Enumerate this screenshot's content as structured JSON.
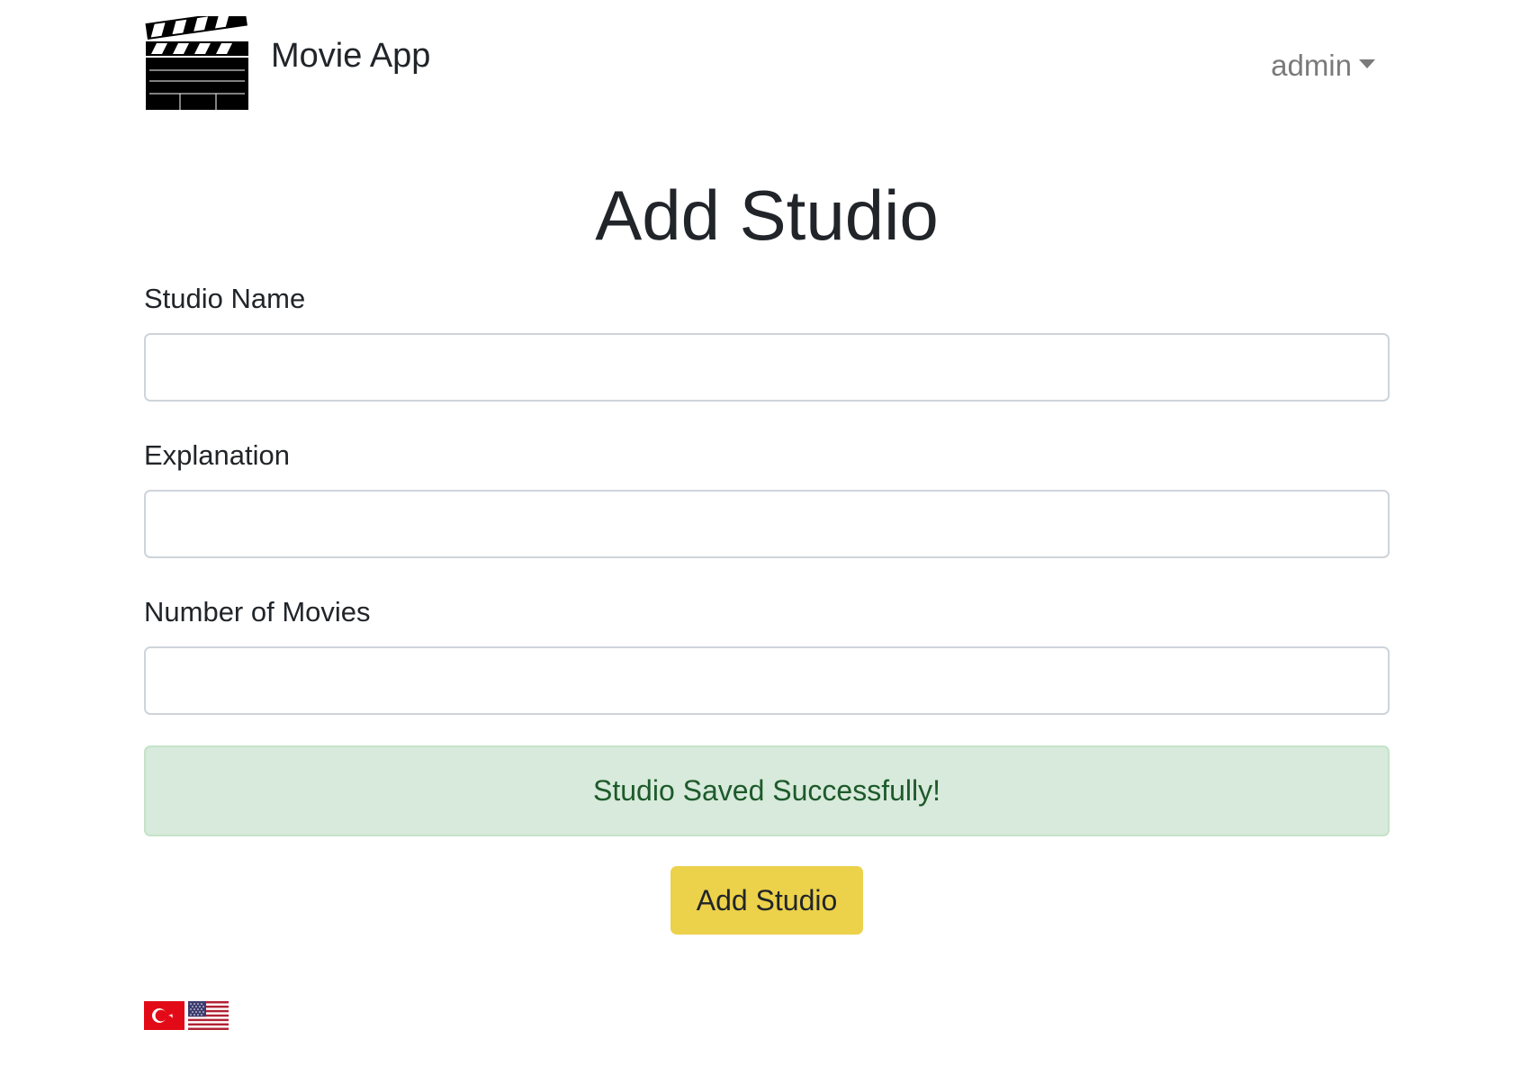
{
  "navbar": {
    "brand_text": "Movie App",
    "logo_icon": "clapperboard-icon",
    "user_label": "admin",
    "user_caret_icon": "caret-down-icon"
  },
  "page": {
    "title": "Add Studio"
  },
  "form": {
    "studio_name_label": "Studio Name",
    "studio_name_value": "",
    "explanation_label": "Explanation",
    "explanation_value": "",
    "movie_count_label": "Number of Movies",
    "movie_count_value": "",
    "submit_label": "Add Studio"
  },
  "alert": {
    "message": "Studio Saved Successfully!",
    "type": "success"
  },
  "languages": [
    {
      "name": "turkish-flag-icon"
    },
    {
      "name": "us-flag-icon"
    }
  ],
  "colors": {
    "alert_bg": "#d8eadb",
    "alert_text": "#1d5a2b",
    "button_bg": "#ecd14a",
    "muted": "#7a7a7a"
  }
}
